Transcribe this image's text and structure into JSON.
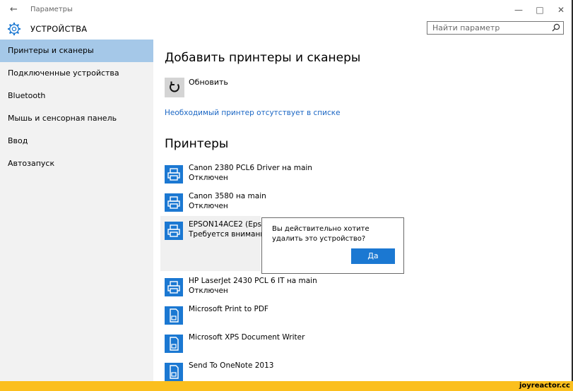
{
  "window": {
    "title": "Параметры"
  },
  "header": {
    "title": "УСТРОЙСТВА",
    "search_placeholder": "Найти параметр"
  },
  "sidebar": {
    "items": [
      {
        "label": "Принтеры и сканеры",
        "active": true
      },
      {
        "label": "Подключенные устройства"
      },
      {
        "label": "Bluetooth"
      },
      {
        "label": "Мышь и сенсорная панель"
      },
      {
        "label": "Ввод"
      },
      {
        "label": "Автозапуск"
      }
    ]
  },
  "main": {
    "add_heading": "Добавить принтеры и сканеры",
    "refresh_label": "Обновить",
    "missing_link": "Необходимый принтер отсутствует в списке",
    "printers_heading": "Принтеры",
    "printers": [
      {
        "name": "Canon 2380 PCL6 Driver на main",
        "status": "Отключен"
      },
      {
        "name": "Canon 3580 на main",
        "status": "Отключен"
      },
      {
        "name": "EPSON14ACE2 (Epson S",
        "status": "Требуется внимание"
      },
      {
        "name": "HP LaserJet 2430 PCL 6 IT на main",
        "status": "Отключен"
      },
      {
        "name": "Microsoft Print to PDF",
        "status": ""
      },
      {
        "name": "Microsoft XPS Document Writer",
        "status": ""
      },
      {
        "name": "Send To OneNote 2013",
        "status": ""
      }
    ]
  },
  "dialog": {
    "text": "Вы действительно хотите удалить это устройство?",
    "confirm_label": "Да"
  },
  "footer": {
    "brand": "joyreactor.cc"
  },
  "colors": {
    "accent": "#1b78d2",
    "nav_active": "#a5c8e8",
    "link": "#1a66c4",
    "band": "#fbbf1e"
  }
}
